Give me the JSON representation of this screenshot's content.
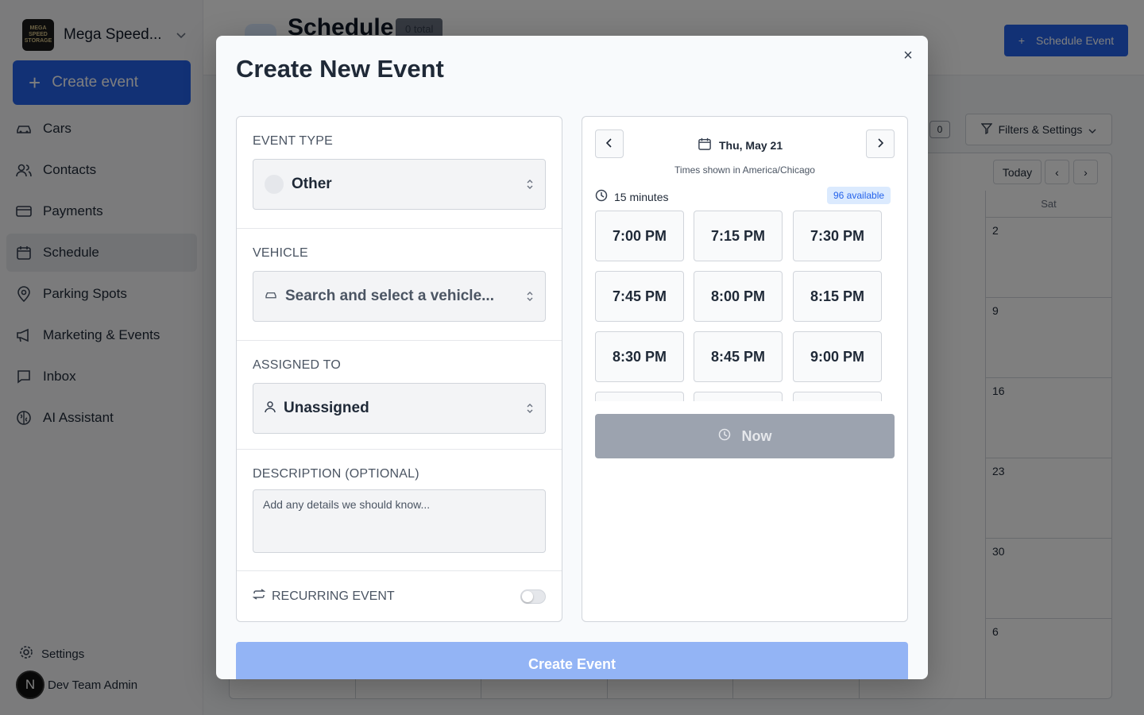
{
  "sidebar": {
    "brand_name": "Mega Speed...",
    "logo_text": "MEGA SPEED STORAGE",
    "create_label": "Create event",
    "items": [
      {
        "label": "Cars",
        "icon": "car-icon"
      },
      {
        "label": "Contacts",
        "icon": "contacts-icon"
      },
      {
        "label": "Payments",
        "icon": "credit-card-icon"
      },
      {
        "label": "Schedule",
        "icon": "calendar-icon"
      },
      {
        "label": "Parking Spots",
        "icon": "map-pin-icon"
      },
      {
        "label": "Marketing & Events",
        "icon": "megaphone-icon"
      },
      {
        "label": "Inbox",
        "icon": "message-icon"
      },
      {
        "label": "AI Assistant",
        "icon": "brain-icon"
      }
    ],
    "settings_label": "Settings",
    "user_initial": "N",
    "user_name": "Dev Team Admin"
  },
  "background": {
    "page_title": "Schedule",
    "total_badge": "0 total",
    "schedule_button": "Schedule Event",
    "filters_label": "Filters & Settings",
    "filter_count": "0",
    "today_label": "Today",
    "day_name": "Sat",
    "dates": [
      "2",
      "9",
      "16",
      "23",
      "30",
      "6"
    ]
  },
  "modal": {
    "title": "Create New Event",
    "close_label": "×",
    "event_type": {
      "label": "EVENT TYPE",
      "value": "Other"
    },
    "vehicle": {
      "label": "VEHICLE",
      "placeholder": "Search and select a vehicle..."
    },
    "assigned": {
      "label": "ASSIGNED TO",
      "value": "Unassigned"
    },
    "description": {
      "label": "DESCRIPTION (OPTIONAL)",
      "placeholder": "Add any details we should know..."
    },
    "recurring": {
      "label": "RECURRING EVENT",
      "enabled": false
    },
    "date_label": "Thu, May 21",
    "timezone_note": "Times shown in America/Chicago",
    "duration": "15 minutes",
    "available": "96 available",
    "slots": [
      "7:00 PM",
      "7:15 PM",
      "7:30 PM",
      "7:45 PM",
      "8:00 PM",
      "8:15 PM",
      "8:30 PM",
      "8:45 PM",
      "9:00 PM",
      "",
      "",
      ""
    ],
    "now_label": "Now",
    "submit_label": "Create Event"
  },
  "colors": {
    "accent": "#2563eb",
    "submit_disabled": "#93b4f5",
    "now_disabled": "#9ca3af",
    "badge_bg": "#dbeafe"
  }
}
